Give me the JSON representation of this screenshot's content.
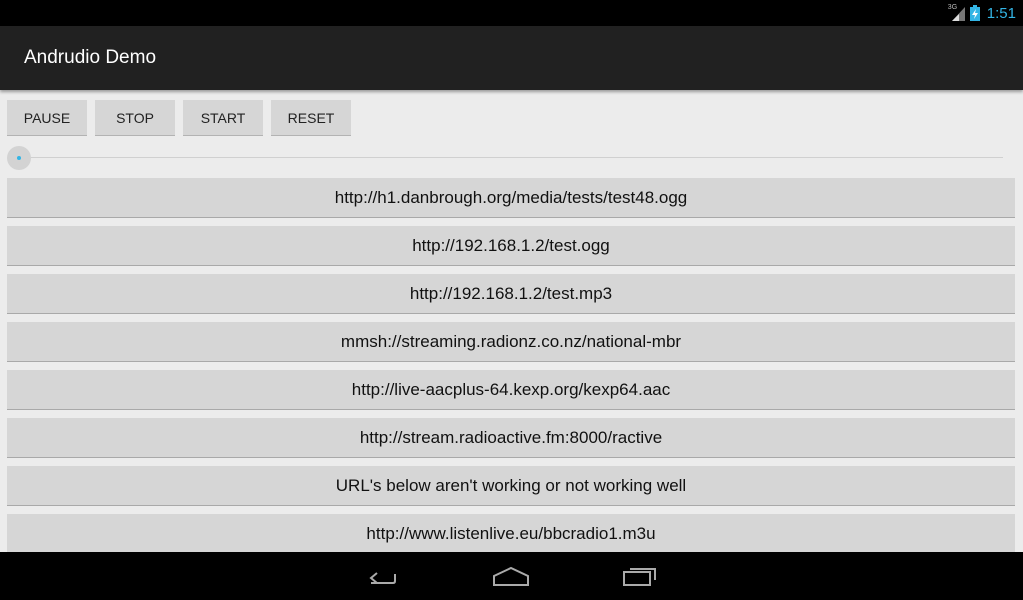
{
  "status_bar": {
    "signal_label": "3G",
    "time": "1:51",
    "icons": [
      "signal-3g-icon",
      "battery-charging-icon"
    ],
    "time_color": "#33b5e5"
  },
  "action_bar": {
    "title": "Andrudio Demo"
  },
  "controls": {
    "pause": "PAUSE",
    "stop": "STOP",
    "start": "START",
    "reset": "RESET"
  },
  "seekbar": {
    "progress": 0,
    "accent_color": "#33b5e5"
  },
  "urls": [
    "http://h1.danbrough.org/media/tests/test48.ogg",
    "http://192.168.1.2/test.ogg",
    "http://192.168.1.2/test.mp3",
    "mmsh://streaming.radionz.co.nz/national-mbr",
    "http://live-aacplus-64.kexp.org/kexp64.aac",
    "http://stream.radioactive.fm:8000/ractive",
    "URL's below aren't working or not working well",
    "http://www.listenlive.eu/bbcradio1.m3u"
  ],
  "nav_bar": {
    "icons": [
      "back-icon",
      "home-icon",
      "recents-icon"
    ]
  }
}
